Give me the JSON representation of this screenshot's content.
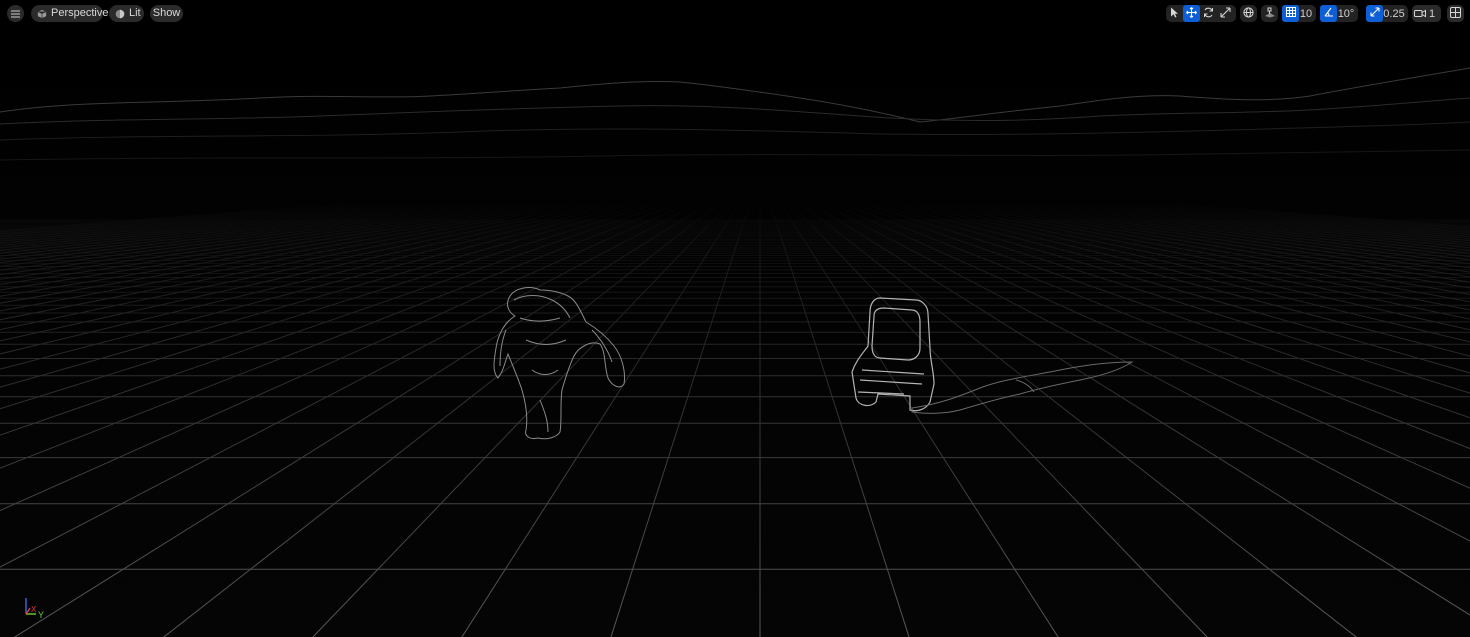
{
  "toolbar": {
    "menu_icon": "hamburger-icon",
    "view_mode_label": "Perspective",
    "lighting_label": "Lit",
    "show_label": "Show"
  },
  "right_toolbar": {
    "grid_snap_value": "10",
    "rotation_snap_value": "10°",
    "scale_snap_value": "0.25",
    "camera_speed_value": "1"
  },
  "axis": {
    "x_label": "X",
    "y_label": "Y",
    "z_label": "Z"
  },
  "colors": {
    "accent_blue": "#0e5fd6",
    "axis_x": "#e23b3b",
    "axis_y": "#6ad23b",
    "axis_z": "#3b6be2"
  }
}
